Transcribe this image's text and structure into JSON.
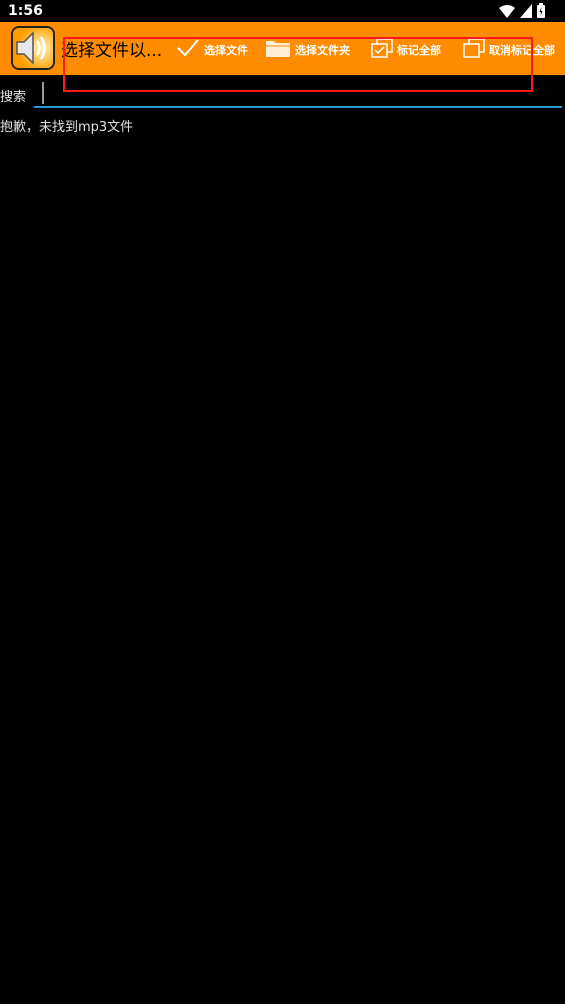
{
  "status_bar": {
    "time": "1:56",
    "icons": [
      "wifi-icon",
      "signal-icon",
      "battery-icon"
    ]
  },
  "toolbar": {
    "background": "#ff8c00",
    "title": "选择文件以...",
    "actions": [
      {
        "label": "选择文件",
        "icon": "checkmark-icon"
      },
      {
        "label": "选择文件夹",
        "icon": "folder-icon"
      },
      {
        "label": "标记全部",
        "icon": "mark-all-icon"
      },
      {
        "label": "取消标记全部",
        "icon": "unmark-all-icon"
      }
    ]
  },
  "search": {
    "label": "搜索",
    "value": "",
    "accent": "#1e9bd7"
  },
  "empty_message": "抱歉，未找到mp3文件",
  "annotation": {
    "color": "#ff1a1a"
  }
}
